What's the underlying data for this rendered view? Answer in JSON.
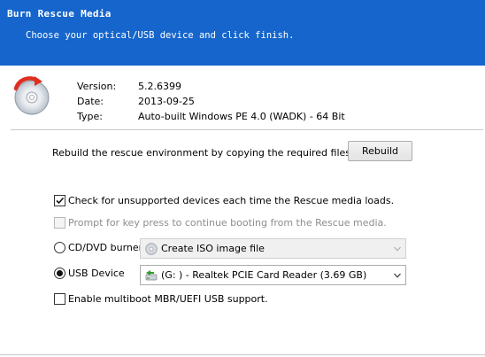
{
  "header": {
    "title": "Burn Rescue Media",
    "subtitle": "Choose your optical/USB device and click finish."
  },
  "info": {
    "version_label": "Version:",
    "version_value": "5.2.6399",
    "date_label": "Date:",
    "date_value": "2013-09-25",
    "type_label": "Type:",
    "type_value": "Auto-built Windows PE 4.0 (WADK) - 64 Bit"
  },
  "rebuild": {
    "text": "Rebuild the rescue environment by copying the required files",
    "button_label": "Rebuild"
  },
  "options": {
    "check_unsupported": {
      "label": "Check for unsupported devices each time the Rescue media loads.",
      "checked": true
    },
    "prompt_key": {
      "label": "Prompt for key press to continue booting from the Rescue media.",
      "checked": false,
      "disabled": true
    },
    "multiboot": {
      "label": "Enable multiboot MBR/UEFI USB support.",
      "checked": false
    }
  },
  "devices": {
    "cd_label": "CD/DVD burner",
    "cd_selected": false,
    "cd_combo_value": "Create ISO image file",
    "cd_combo_icon": "disc-icon",
    "usb_label": "USB Device",
    "usb_selected": true,
    "usb_combo_value": "(G: ) - Realtek PCIE Card Reader (3.69 GB)",
    "usb_combo_icon": "usb-drive-icon"
  },
  "colors": {
    "header_bg": "#1565cc",
    "header_text": "#ffffff",
    "disabled_text": "#8d8d8d"
  }
}
